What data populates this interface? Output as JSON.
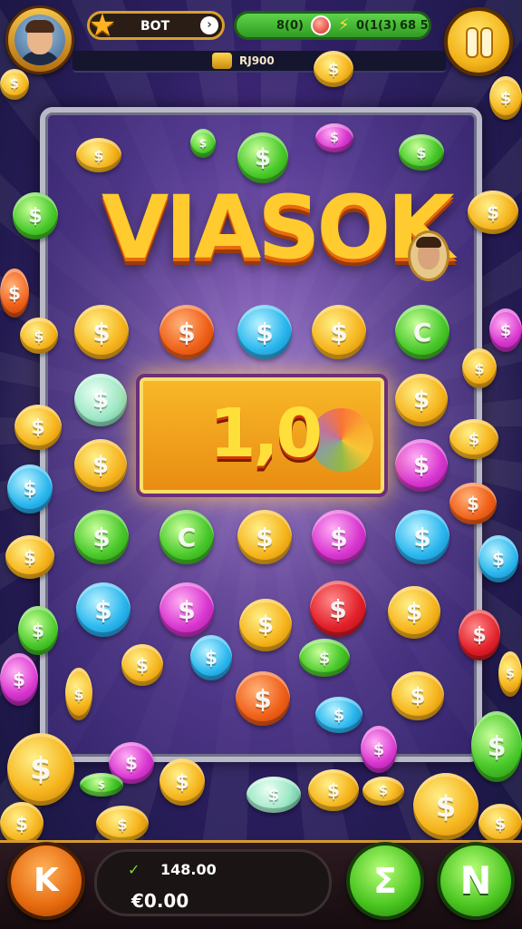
{
  "top_hud": {
    "level_label": "BOT",
    "green_text_1": "8(0)",
    "green_text_2": "0(1(3)",
    "green_text_3": "68 5",
    "sub_value": "RJ900"
  },
  "board": {
    "title": "VIASOK",
    "win_amount": "1,0",
    "coin_symbol": "$",
    "alt_symbol": "C"
  },
  "bottom_hud": {
    "bet_value": "148.00",
    "balance_value": "€0.00",
    "back_label": "K",
    "spin_label": "Σ",
    "next_label": "N"
  },
  "colors": {
    "gold": "#f6b51d",
    "green": "#49c92a",
    "blue": "#2ab7ee",
    "pink": "#d936d0",
    "red": "#e2202a",
    "orange": "#f06019"
  },
  "icons": [
    "star-icon",
    "gem-icon",
    "bolt-icon",
    "coin-stack-icon",
    "pause-icon",
    "check-icon",
    "rainbow-icon"
  ]
}
